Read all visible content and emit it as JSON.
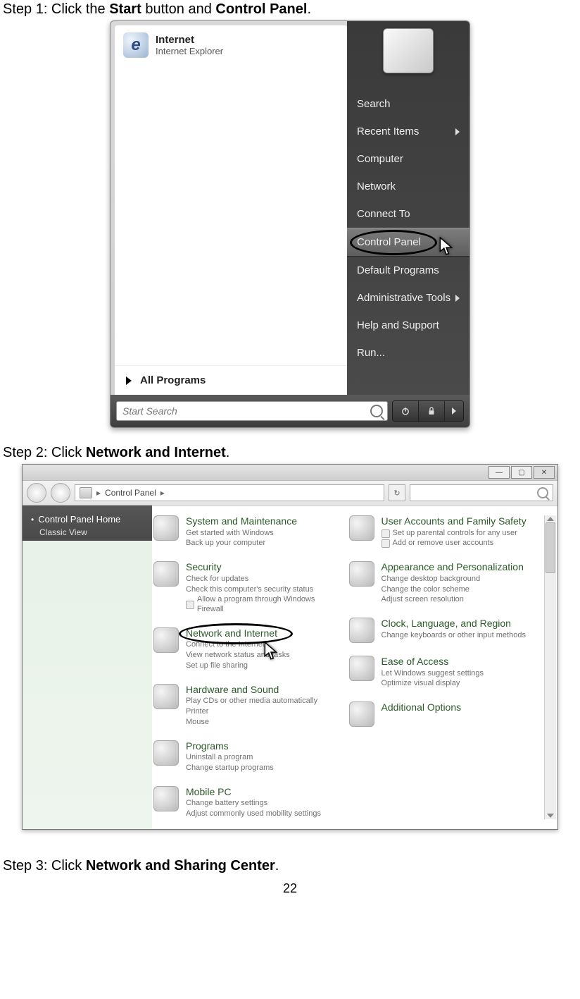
{
  "step1": {
    "prefix": "Step 1: Click the ",
    "bold1": "Start",
    "mid": " button and ",
    "bold2": "Control Panel",
    "suffix": "."
  },
  "start_menu": {
    "app": {
      "title": "Internet",
      "subtitle": "Internet Explorer",
      "icon_letter": "e"
    },
    "all_programs": "All Programs",
    "right_items": [
      {
        "label": "Search",
        "arrow": false,
        "selected": false
      },
      {
        "label": "Recent Items",
        "arrow": true,
        "selected": false
      },
      {
        "label": "Computer",
        "arrow": false,
        "selected": false
      },
      {
        "label": "Network",
        "arrow": false,
        "selected": false
      },
      {
        "label": "Connect To",
        "arrow": false,
        "selected": false
      },
      {
        "label": "Control Panel",
        "arrow": false,
        "selected": true
      },
      {
        "label": "Default Programs",
        "arrow": false,
        "selected": false
      },
      {
        "label": "Administrative Tools",
        "arrow": true,
        "selected": false
      },
      {
        "label": "Help and Support",
        "arrow": false,
        "selected": false
      },
      {
        "label": "Run...",
        "arrow": false,
        "selected": false
      }
    ],
    "search_placeholder": "Start Search"
  },
  "step2": {
    "prefix": "Step 2: Click ",
    "bold": "Network and Internet",
    "suffix": "."
  },
  "control_panel": {
    "breadcrumb": "Control Panel",
    "sidebar": {
      "home": "Control Panel Home",
      "classic": "Classic View"
    },
    "left_column": [
      {
        "title": "System and Maintenance",
        "subs": [
          "Get started with Windows",
          "Back up your computer"
        ]
      },
      {
        "title": "Security",
        "subs": [
          "Check for updates",
          "Check this computer's security status",
          "Allow a program through Windows Firewall"
        ]
      },
      {
        "title": "Network and Internet",
        "circled": true,
        "subs": [
          "Connect to the Internet",
          "View network status and tasks",
          "Set up file sharing"
        ]
      },
      {
        "title": "Hardware and Sound",
        "subs": [
          "Play CDs or other media automatically",
          "Printer",
          "Mouse"
        ]
      },
      {
        "title": "Programs",
        "subs": [
          "Uninstall a program",
          "Change startup programs"
        ]
      },
      {
        "title": "Mobile PC",
        "subs": [
          "Change battery settings",
          "Adjust commonly used mobility settings"
        ]
      }
    ],
    "right_column": [
      {
        "title": "User Accounts and Family Safety",
        "subs_mini": [
          "Set up parental controls for any user",
          "Add or remove user accounts"
        ]
      },
      {
        "title": "Appearance and Personalization",
        "subs": [
          "Change desktop background",
          "Change the color scheme",
          "Adjust screen resolution"
        ]
      },
      {
        "title": "Clock, Language, and Region",
        "subs": [
          "Change keyboards or other input methods"
        ]
      },
      {
        "title": "Ease of Access",
        "subs": [
          "Let Windows suggest settings",
          "Optimize visual display"
        ]
      },
      {
        "title": "Additional Options",
        "subs": []
      }
    ]
  },
  "step3": {
    "prefix": "Step 3: Click ",
    "bold": "Network and Sharing Center",
    "suffix": "."
  },
  "page_number": "22"
}
